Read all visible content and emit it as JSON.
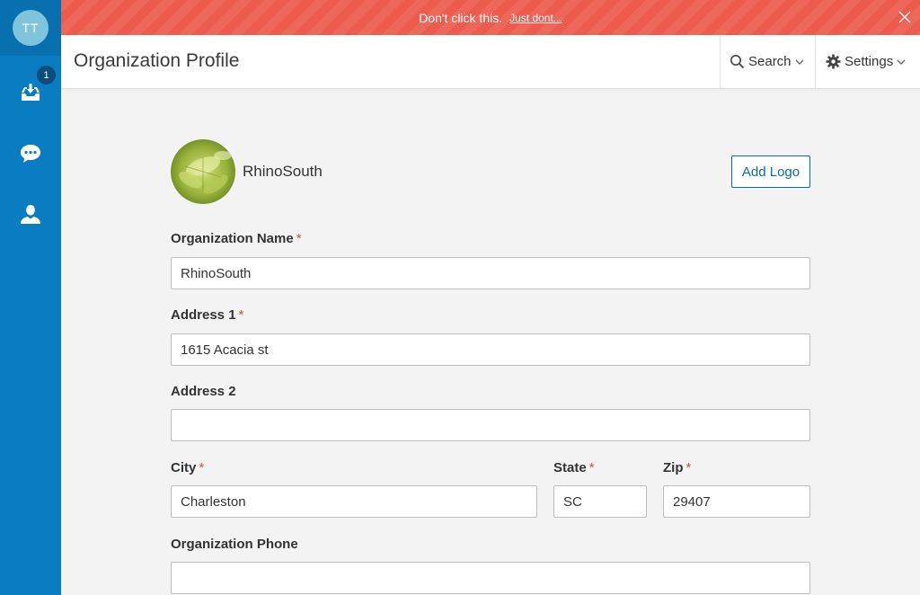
{
  "sidebar": {
    "avatar_initials": "TT",
    "inbox_badge": "1",
    "items": [
      {
        "icon": "inbox-download-icon"
      },
      {
        "icon": "chat-bubble-icon"
      },
      {
        "icon": "user-icon"
      }
    ]
  },
  "banner": {
    "message": "Don't click this.",
    "link": "Just dont...",
    "color": "#ec5c4e"
  },
  "header": {
    "title": "Organization Profile",
    "search_label": "Search",
    "settings_label": "Settings"
  },
  "org": {
    "name": "RhinoSouth",
    "add_logo_label": "Add Logo"
  },
  "form": {
    "org_name": {
      "label": "Organization Name",
      "value": "RhinoSouth",
      "required": "*"
    },
    "address1": {
      "label": "Address 1",
      "value": "1615 Acacia st",
      "required": "*"
    },
    "address2": {
      "label": "Address 2",
      "value": ""
    },
    "city": {
      "label": "City",
      "value": "Charleston",
      "required": "*"
    },
    "state": {
      "label": "State",
      "value": "SC",
      "required": "*"
    },
    "zip": {
      "label": "Zip",
      "value": "29407",
      "required": "*"
    },
    "phone": {
      "label": "Organization Phone",
      "value": ""
    }
  },
  "colors": {
    "sidebar": "#0a7cc1",
    "accent": "#0a6aa5",
    "required": "#e04a3c"
  }
}
